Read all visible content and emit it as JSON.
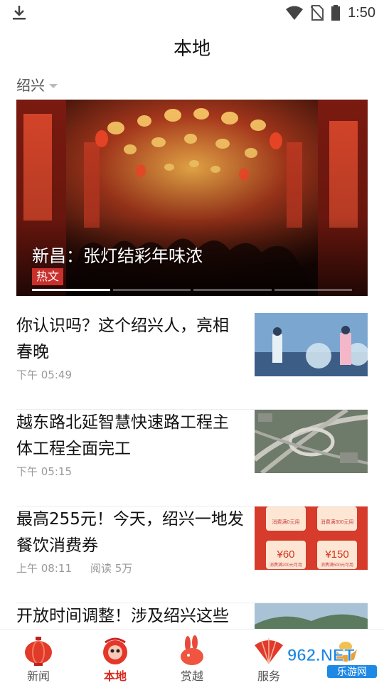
{
  "status_bar": {
    "time": "1:50"
  },
  "header": {
    "title": "本地"
  },
  "location": {
    "city": "绍兴"
  },
  "banner": {
    "caption": "新昌：张灯结彩年味浓",
    "tag": "热文",
    "slide_count": 4,
    "active_slide": 1
  },
  "news": [
    {
      "title": "你认识吗？这个绍兴人，亮相春晚",
      "time": "下午 05:49",
      "reads": ""
    },
    {
      "title": "越东路北延智慧快速路工程主体工程全面完工",
      "time": "下午 05:15",
      "reads": ""
    },
    {
      "title": "最高255元！今天，绍兴一地发餐饮消费券",
      "time": "上午 08:11",
      "reads": "阅读  5万"
    },
    {
      "title": "开放时间调整！涉及绍兴这些",
      "time": "",
      "reads": ""
    }
  ],
  "thumb_text": {
    "coupon_top_left": "消费满0元用",
    "coupon_top_right": "消费满300元用",
    "coupon_60": "¥60",
    "coupon_150": "¥150",
    "coupon_bottom_left": "消费满200元可用",
    "coupon_bottom_right": "消费满500元可用"
  },
  "tabs": [
    {
      "label": "新闻",
      "icon": "lantern-icon"
    },
    {
      "label": "本地",
      "icon": "lion-head-icon"
    },
    {
      "label": "赏越",
      "icon": "rabbit-icon"
    },
    {
      "label": "服务",
      "icon": "fan-icon"
    },
    {
      "label": "",
      "icon": "ingot-icon"
    }
  ],
  "active_tab": "本地",
  "watermark": {
    "main": "962.NET",
    "sub": "乐游网"
  },
  "colors": {
    "accent": "#d8271c",
    "tag": "#c9302c",
    "divider": "#eeeeee"
  }
}
